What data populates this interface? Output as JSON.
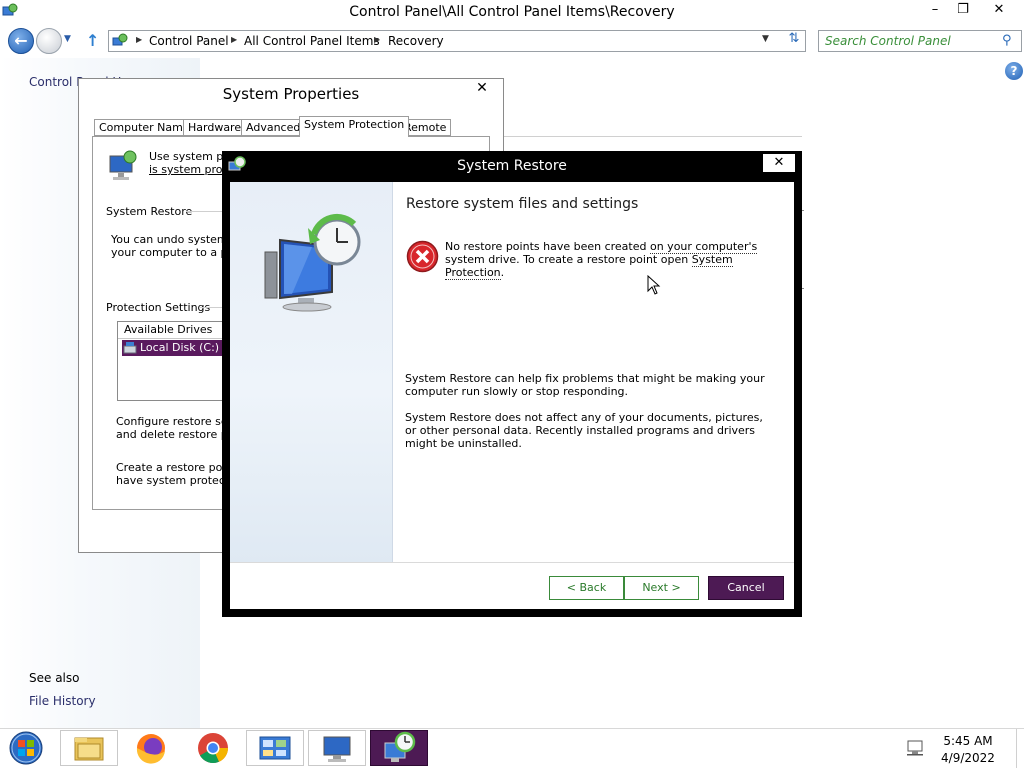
{
  "window": {
    "title": "Control Panel\\All Control Panel Items\\Recovery",
    "minimize_glyph": "–",
    "restore_glyph": "❐",
    "close_glyph": "✕"
  },
  "navigation": {
    "breadcrumbs": [
      "Control Panel",
      "All Control Panel Items",
      "Recovery"
    ],
    "search_placeholder": "Search Control Panel"
  },
  "left_pane": {
    "home_link": "Control Panel Home",
    "see_also": "See also",
    "file_history": "File History"
  },
  "system_properties": {
    "title": "System Properties",
    "tabs": [
      "Computer Name",
      "Hardware",
      "Advanced",
      "System Protection",
      "Remote"
    ],
    "active_tab": "System Protection",
    "intro_line1": "Use system pro",
    "intro_line2": "is system protec",
    "restore_group": "System Restore",
    "restore_desc_line1": "You can undo system c",
    "restore_desc_line2": "your computer to a prev",
    "protection_group": "Protection Settings",
    "list_header": "Available Drives",
    "list_row": "Local Disk (C:) (S",
    "configure_line1": "Configure restore settin",
    "configure_line2": "and delete restore poin",
    "create_line1": "Create a restore point r",
    "create_line2": "have system protection"
  },
  "system_restore": {
    "title": "System Restore",
    "heading": "Restore system files and settings",
    "error_part1": "No restore points have been created ",
    "error_part2": "on your computer's",
    "error_part3": " system drive. To create a restore point open ",
    "error_link": "System Protection",
    "error_end": ".",
    "info1": "System Restore can help fix problems that might be making your computer run slowly or stop responding.",
    "info2": "System Restore does not affect any of your documents, pictures, or other personal data. Recently installed programs and drivers might be uninstalled.",
    "buttons": {
      "back": "< Back",
      "next": "Next >",
      "cancel": "Cancel"
    }
  },
  "taskbar": {
    "apps": [
      "File Explorer",
      "Firefox",
      "Chrome",
      "Control Panel",
      "System Properties",
      "System Restore"
    ],
    "time": "5:45 AM",
    "date": "4/9/2022"
  },
  "colors": {
    "accent_purple": "#4d1a54",
    "button_green": "#2a7a2a",
    "link_blue": "#2b2f6b"
  }
}
